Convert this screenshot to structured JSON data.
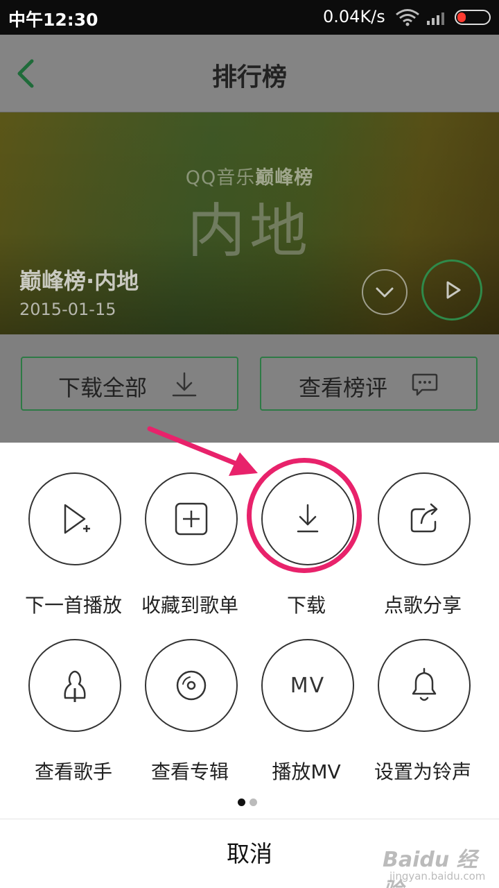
{
  "status_bar": {
    "time": "中午12:30",
    "speed": "0.04K/s"
  },
  "header": {
    "title": "排行榜"
  },
  "banner": {
    "brand_prefix": "QQ音乐",
    "brand_suffix": "巅峰榜",
    "big_text": "内地",
    "chart_name": "巅峰榜·内地",
    "date": "2015-01-15"
  },
  "actions": {
    "download_all": "下载全部",
    "view_comments": "查看榜评"
  },
  "sheet": {
    "row1": [
      {
        "label": "下一首播放",
        "icon": "play-next-icon"
      },
      {
        "label": "收藏到歌单",
        "icon": "add-to-playlist-icon"
      },
      {
        "label": "下载",
        "icon": "download-icon"
      },
      {
        "label": "点歌分享",
        "icon": "share-icon"
      }
    ],
    "row2": [
      {
        "label": "查看歌手",
        "icon": "singer-icon"
      },
      {
        "label": "查看专辑",
        "icon": "album-icon"
      },
      {
        "label": "播放MV",
        "icon": "mv-icon",
        "glyph": "MV"
      },
      {
        "label": "设置为铃声",
        "icon": "bell-icon"
      }
    ],
    "cancel": "取消",
    "page_indicator": {
      "current": 1,
      "total": 2
    }
  },
  "watermark": {
    "brand": "Baidu 经验",
    "url": "jingyan.baidu.com"
  },
  "colors": {
    "accent_green": "#2d7a45",
    "highlight_pink": "#e8226b"
  }
}
